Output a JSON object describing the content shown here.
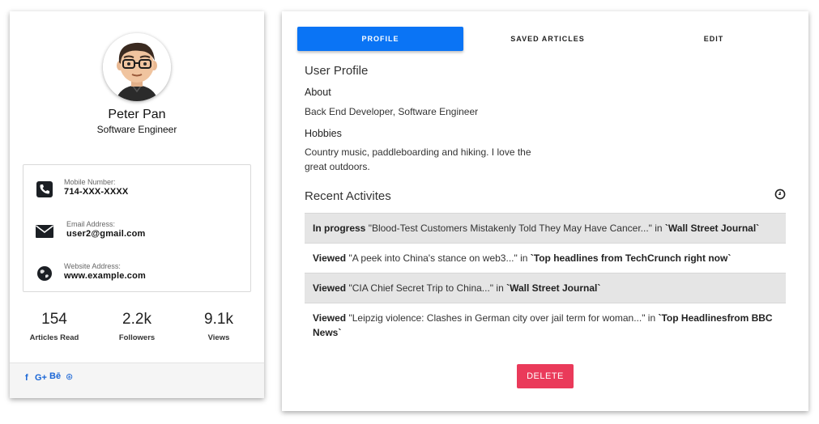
{
  "profile": {
    "name": "Peter Pan",
    "role": "Software Engineer",
    "contacts": [
      {
        "icon": "phone-icon",
        "label": "Mobile Number:",
        "value": "714-XXX-XXXX"
      },
      {
        "icon": "mail-icon",
        "label": "Email Address:",
        "value": "user2@gmail.com"
      },
      {
        "icon": "globe-icon",
        "label": "Website Address:",
        "value": "www.example.com"
      }
    ],
    "stats": [
      {
        "value": "154",
        "label": "Articles Read"
      },
      {
        "value": "2.2k",
        "label": "Followers"
      },
      {
        "value": "9.1k",
        "label": "Views"
      }
    ],
    "social": {
      "facebook": "f",
      "google_plus": "G+",
      "behance": "Bē",
      "dribbble": "⊛"
    }
  },
  "tabs": [
    {
      "label": "PROFILE",
      "active": true
    },
    {
      "label": "SAVED ARTICLES",
      "active": false
    },
    {
      "label": "EDIT",
      "active": false
    }
  ],
  "user_profile": {
    "title": "User Profile",
    "about_heading": "About",
    "about_text": "Back End Developer, Software Engineer",
    "hobbies_heading": "Hobbies",
    "hobbies_text": "Country music, paddleboarding and hiking. I love the great outdoors."
  },
  "recent": {
    "title": "Recent Activites",
    "items": [
      {
        "status": "In progress",
        "text": " \"Blood-Test Customers Mistakenly Told They May Have Cancer...\" in ",
        "source": "`Wall Street Journal`"
      },
      {
        "status": "Viewed",
        "text": " \"A peek into China's stance on web3...\" in ",
        "source": "`Top headlines from TechCrunch right now`"
      },
      {
        "status": "Viewed",
        "text": " \"CIA Chief Secret Trip to China...\" in ",
        "source": "`Wall Street Journal`"
      },
      {
        "status": "Viewed",
        "text": " \"Leipzig violence: Clashes in German city over jail term for woman...\" in ",
        "source": "`Top Headlinesfrom BBC News`"
      }
    ]
  },
  "actions": {
    "delete_label": "DELETE"
  },
  "colors": {
    "accent": "#0a74f5",
    "danger": "#ea3a5a",
    "link": "#1a66d6"
  }
}
